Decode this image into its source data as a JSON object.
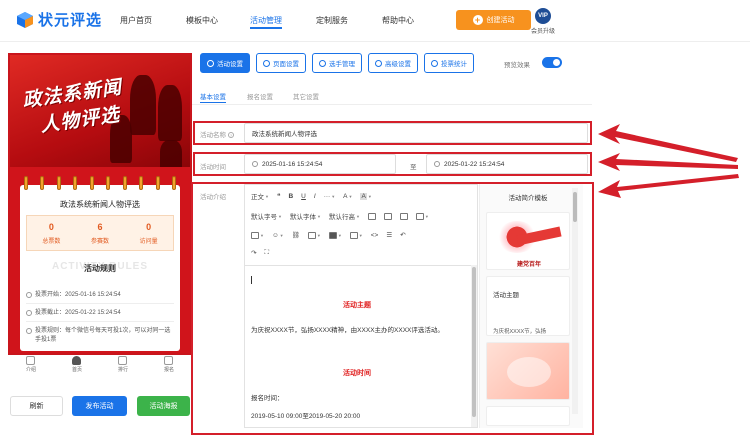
{
  "brand": {
    "name": "状元评选"
  },
  "nav": {
    "items": [
      {
        "label": "用户首页",
        "active": false
      },
      {
        "label": "模板中心",
        "active": false
      },
      {
        "label": "活动管理",
        "active": true
      },
      {
        "label": "定制服务",
        "active": false
      },
      {
        "label": "帮助中心",
        "active": false
      }
    ],
    "create_label": "创建活动",
    "vip_badge": "VIP",
    "vip_label": "会员升级"
  },
  "preview": {
    "banner_line1": "政法系新闻",
    "banner_line2": "人物评选",
    "card_title": "政法系统新闻人物评选",
    "stats": [
      {
        "value": "0",
        "label": "总票数"
      },
      {
        "value": "6",
        "label": "参赛数"
      },
      {
        "value": "0",
        "label": "访问量"
      }
    ],
    "rules_bg": "ACTIVITY RULES",
    "rules_title": "活动规则",
    "rules": [
      {
        "text": "投票开始：2025-01-16 15:24:54"
      },
      {
        "text": "投票截止：2025-01-22 15:24:54"
      },
      {
        "text": "投票规则：每个微信号每天可投1次，可以对同一选手投1票"
      }
    ]
  },
  "bottom_nav": [
    {
      "label": "介绍",
      "active": false
    },
    {
      "label": "首页",
      "active": true
    },
    {
      "label": "排行",
      "active": false
    },
    {
      "label": "报名",
      "active": false
    }
  ],
  "actions": {
    "refresh": "刷新",
    "publish": "发布活动",
    "poster": "活动海报"
  },
  "tabs": [
    {
      "label": "活动设置",
      "active": true
    },
    {
      "label": "页面设置",
      "active": false
    },
    {
      "label": "选手管理",
      "active": false
    },
    {
      "label": "高级设置",
      "active": false
    },
    {
      "label": "投票统计",
      "active": false
    }
  ],
  "preview_toggle": {
    "label": "预览效果",
    "on": true
  },
  "subtabs": [
    {
      "label": "基本设置",
      "active": true
    },
    {
      "label": "报名设置",
      "active": false
    },
    {
      "label": "其它设置",
      "active": false
    }
  ],
  "form": {
    "name_label": "活动名称",
    "name_value": "政法系统新闻人物评选",
    "time_label": "活动时间",
    "start": "2025-01-16 15:24:54",
    "separator": "至",
    "end": "2025-01-22 15:24:54",
    "intro_label": "活动介绍"
  },
  "editor": {
    "toolbar_row1": [
      "正文",
      "B",
      "U",
      "I",
      "···",
      "A",
      "A"
    ],
    "toolbar_row2": [
      "默认字号",
      "默认字体",
      "默认行高"
    ],
    "heading1": "活动主题",
    "body1": "为庆祝XXXX节，弘扬XXXX精神，由XXXX主办的XXXX评选活动。",
    "heading2": "活动时间",
    "body2": "报名时间：",
    "body3": "2019-05-10 09:00至2019-05-20 20:00"
  },
  "templates": {
    "title": "活动简介模板",
    "card2_label": "活动主题",
    "card1_caption": "建党百年",
    "card2_caption": "为庆祝XXXX节，弘扬"
  },
  "colors": {
    "primary": "#1a73e8",
    "orange": "#f7921e",
    "red": "#d41f2a",
    "green": "#3cb34a"
  }
}
